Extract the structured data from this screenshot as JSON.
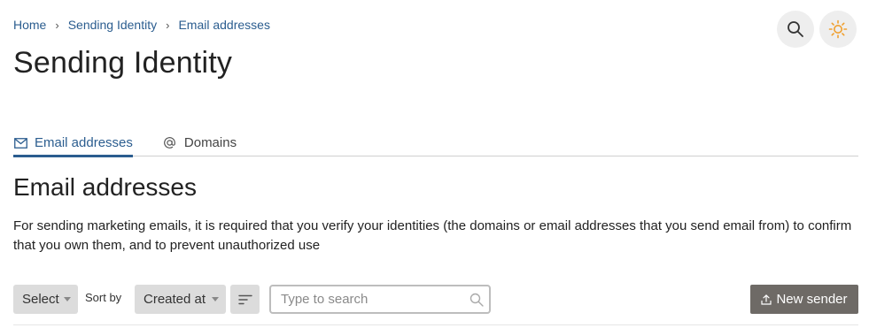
{
  "breadcrumb": {
    "items": [
      "Home",
      "Sending Identity",
      "Email addresses"
    ],
    "separator": "›"
  },
  "header": {
    "title": "Sending Identity",
    "icons": [
      "search-icon",
      "sun-icon"
    ],
    "theme_icon_color": "#f0a030"
  },
  "tabs": [
    {
      "label": "Email addresses",
      "icon": "mail-icon",
      "active": true
    },
    {
      "label": "Domains",
      "icon": "at-icon",
      "active": false
    }
  ],
  "section": {
    "title": "Email addresses",
    "description": "For sending marketing emails, it is required that you verify your identities (the domains or email addresses that you send email from) to confirm that you own them, and to prevent unauthorized use"
  },
  "toolbar": {
    "select_label": "Select",
    "sort_by_label": "Sort by",
    "sort_value": "Created at",
    "search_placeholder": "Type to search",
    "search_value": "",
    "new_sender_label": "New sender"
  },
  "colors": {
    "link": "#2b5d8f",
    "primary_button": "#6e6a66",
    "control_bg": "#dcdcdc"
  }
}
